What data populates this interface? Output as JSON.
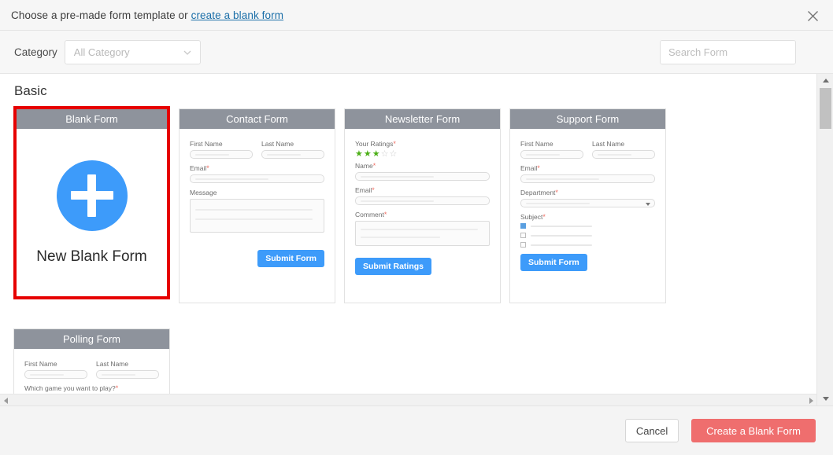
{
  "header": {
    "title_prefix": "Choose a pre-made form template or ",
    "link_label": "create a blank form",
    "close_icon": "close-icon"
  },
  "toolbar": {
    "category_label": "Category",
    "category_value": "All Category",
    "chevron_icon": "chevron-down-icon",
    "search_placeholder": "Search Form",
    "search_value": "",
    "search_icon": "search-icon"
  },
  "section": {
    "title": "Basic"
  },
  "colors": {
    "accent_blue": "#3d9bfa",
    "header_gray": "#8e939c",
    "selected_red": "#e60000",
    "create_coral": "#ef6e6e",
    "star_green": "#4caf17",
    "required_red": "#f06f64"
  },
  "cards": [
    {
      "id": "blank-form",
      "title": "Blank Form",
      "selected": true,
      "plus_icon": "plus-circle-icon",
      "body_label": "New Blank Form"
    },
    {
      "id": "contact-form",
      "title": "Contact Form",
      "selected": false,
      "fields": [
        {
          "label": "First Name",
          "required": false
        },
        {
          "label": "Last Name",
          "required": false
        },
        {
          "label": "Email",
          "required": true
        },
        {
          "label": "Message",
          "required": false
        }
      ],
      "submit_label": "Submit Form"
    },
    {
      "id": "newsletter-form",
      "title": "Newsletter Form",
      "selected": false,
      "ratings_label": "Your Ratings",
      "ratings_filled": 3,
      "ratings_total": 5,
      "fields": [
        {
          "label": "Name",
          "required": true
        },
        {
          "label": "Email",
          "required": true
        },
        {
          "label": "Comment",
          "required": true
        }
      ],
      "submit_label": "Submit Ratings"
    },
    {
      "id": "support-form",
      "title": "Support Form",
      "selected": false,
      "fields": [
        {
          "label": "First Name",
          "required": false
        },
        {
          "label": "Last Name",
          "required": false
        },
        {
          "label": "Email",
          "required": true
        },
        {
          "label": "Department",
          "required": true
        },
        {
          "label": "Subject",
          "required": true
        }
      ],
      "checkbox_count": 3,
      "checkbox_checked_index": 0,
      "submit_label": "Submit Form"
    },
    {
      "id": "polling-form",
      "title": "Polling Form",
      "selected": false,
      "fields": [
        {
          "label": "First Name",
          "required": false
        },
        {
          "label": "Last Name",
          "required": false
        },
        {
          "label": "Which game you want to play?",
          "required": true
        }
      ]
    }
  ],
  "scrollbars": {
    "vertical_up_icon": "scroll-up-arrow-icon",
    "vertical_down_icon": "scroll-down-arrow-icon",
    "horizontal_left_icon": "scroll-left-arrow-icon",
    "horizontal_right_icon": "scroll-right-arrow-icon"
  },
  "footer": {
    "cancel_label": "Cancel",
    "create_label": "Create a Blank Form"
  }
}
